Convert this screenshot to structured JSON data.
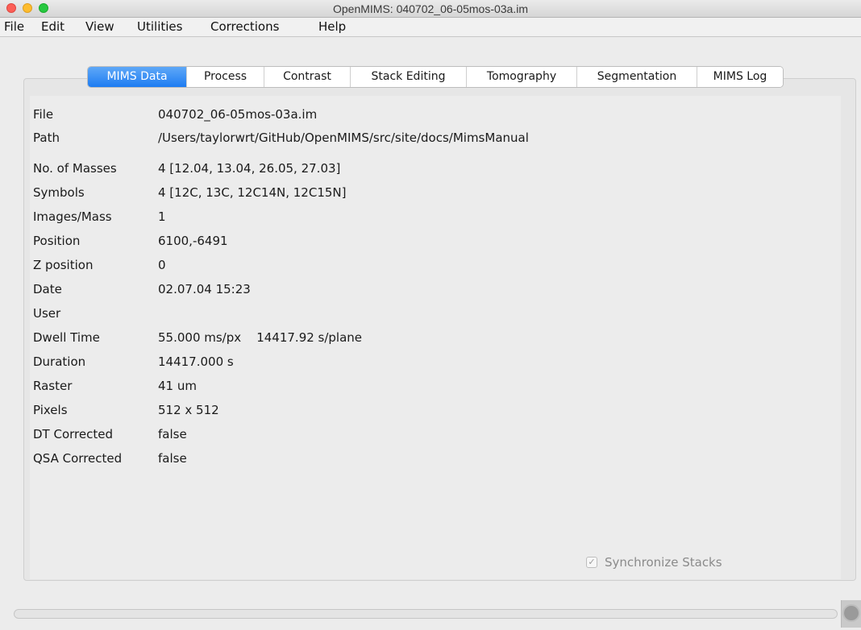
{
  "window": {
    "title": "OpenMIMS: 040702_06-05mos-03a.im"
  },
  "menu": [
    "File",
    "Edit",
    "View",
    "Utilities",
    "Corrections",
    "Help"
  ],
  "tabs": [
    "MIMS Data",
    "Process",
    "Contrast",
    "Stack Editing",
    "Tomography",
    "Segmentation",
    "MIMS Log"
  ],
  "active_tab": "MIMS Data",
  "info": [
    {
      "label": "File",
      "value": "040702_06-05mos-03a.im"
    },
    {
      "label": "Path",
      "value": "/Users/taylorwrt/GitHub/OpenMIMS/src/site/docs/MimsManual"
    },
    {
      "label": "No. of Masses",
      "value": "4 [12.04, 13.04, 26.05, 27.03]"
    },
    {
      "label": "Symbols",
      "value": "4 [12C, 13C, 12C14N, 12C15N]"
    },
    {
      "label": "Images/Mass",
      "value": "1"
    },
    {
      "label": "Position",
      "value": "6100,-6491"
    },
    {
      "label": "Z position",
      "value": "0"
    },
    {
      "label": "Date",
      "value": "02.07.04 15:23"
    },
    {
      "label": "User",
      "value": ""
    },
    {
      "label": "Dwell Time",
      "value": "55.000 ms/px    14417.92 s/plane"
    },
    {
      "label": "Duration",
      "value": "14417.000 s"
    },
    {
      "label": "Raster",
      "value": "41 um"
    },
    {
      "label": "Pixels",
      "value": "512 x 512"
    },
    {
      "label": "DT Corrected",
      "value": "false"
    },
    {
      "label": "QSA Corrected",
      "value": "false"
    }
  ],
  "synchronize": {
    "label": "Synchronize Stacks",
    "checked": true,
    "enabled": false
  },
  "colors": {
    "active_tab": "#1d7cf2",
    "close": "#fc5f57",
    "minimize": "#fdbc2e",
    "maximize": "#27c840"
  }
}
